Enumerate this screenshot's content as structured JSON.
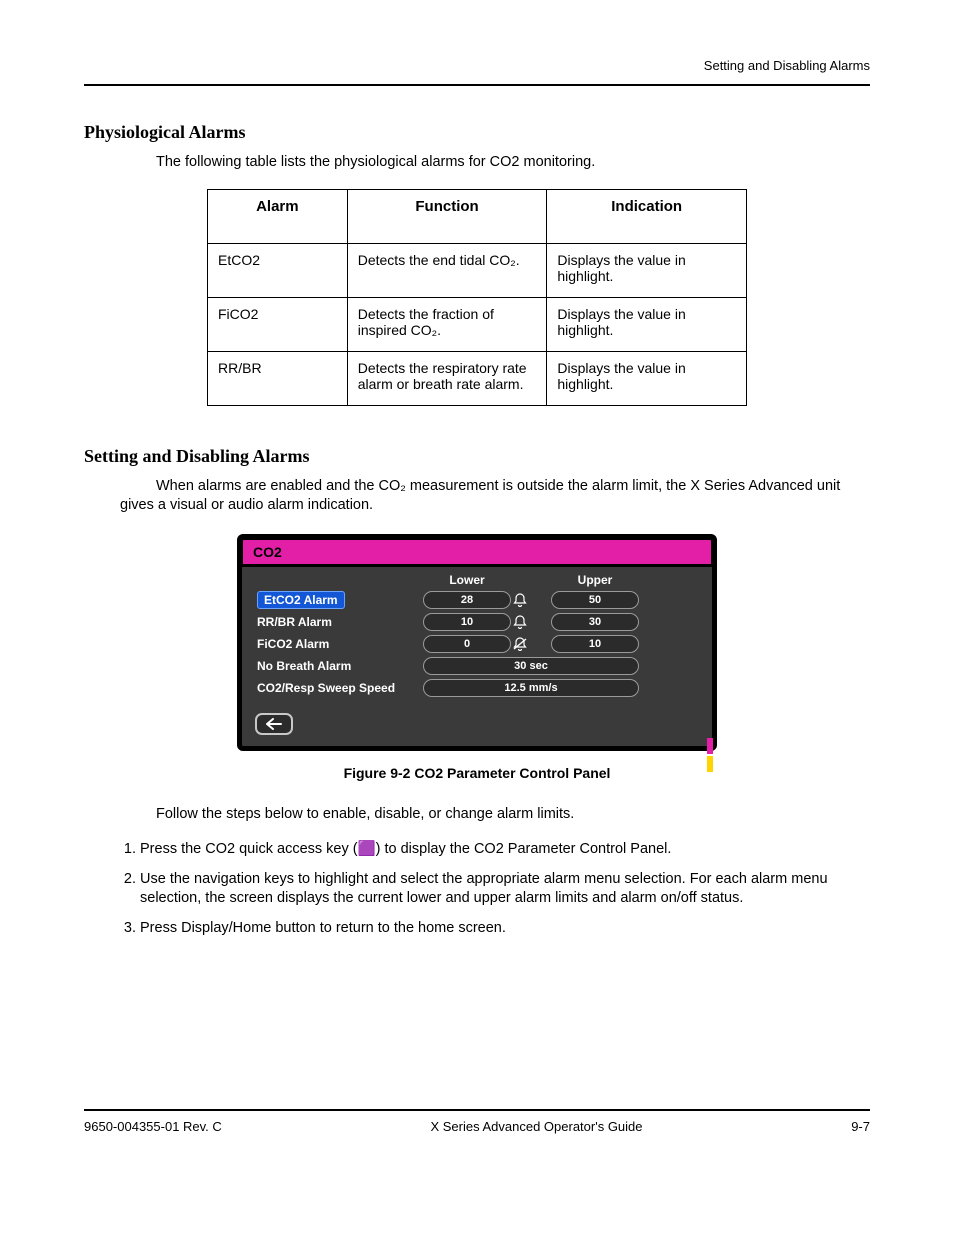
{
  "header": {
    "right": "Setting and Disabling Alarms"
  },
  "sect1": {
    "title": "Physiological Alarms",
    "para": "The following table lists the physiological alarms for CO2 monitoring."
  },
  "table": {
    "headers": {
      "c1": "Alarm",
      "c2": "Function",
      "c3": "Indication"
    },
    "rows": [
      {
        "c1": "EtCO2",
        "c2": "Detects the end tidal CO₂.",
        "c3": "Displays the value in highlight."
      },
      {
        "c1": "FiCO2",
        "c2": "Detects the fraction of inspired CO₂.",
        "c3": "Displays the value in highlight."
      },
      {
        "c1": "RR/BR",
        "c2": "Detects the respiratory rate alarm or breath rate alarm.",
        "c3": "Displays the value in highlight."
      }
    ]
  },
  "sect2": {
    "title": "Setting and Disabling Alarms",
    "para": "When alarms are enabled and the CO₂ measurement is outside the alarm limit, the X Series Advanced unit gives a visual or audio alarm indication."
  },
  "device": {
    "title": "CO2",
    "columns": {
      "lower": "Lower",
      "upper": "Upper"
    },
    "rows": {
      "etco2": {
        "label": "EtCO2 Alarm",
        "lower": "28",
        "upper": "50",
        "bell": "on"
      },
      "rrbr": {
        "label": "RR/BR Alarm",
        "lower": "10",
        "upper": "30",
        "bell": "on"
      },
      "fico2": {
        "label": "FiCO2 Alarm",
        "lower": "0",
        "upper": "10",
        "bell": "off"
      },
      "nobreath": {
        "label": "No Breath Alarm",
        "value": "30 sec"
      },
      "sweep": {
        "label": "CO2/Resp Sweep Speed",
        "value": "12.5 mm/s"
      }
    }
  },
  "figure": {
    "caption": "Figure 9-2 CO2 Parameter Control Panel"
  },
  "steps": {
    "intro": "Follow the steps below to enable, disable, or change alarm limits.",
    "items": [
      "Press the CO2 quick access key (🟪) to display the CO2 Parameter Control Panel.",
      "Use the navigation keys to highlight and select the appropriate alarm menu selection. For each alarm menu selection, the screen displays the current lower and upper alarm limits and alarm on/off status.",
      "Press Display/Home button to return to the home screen."
    ]
  },
  "footer": {
    "left": "9650-004355-01 Rev. C",
    "center": "X Series Advanced Operator's Guide",
    "right": "9-7"
  }
}
